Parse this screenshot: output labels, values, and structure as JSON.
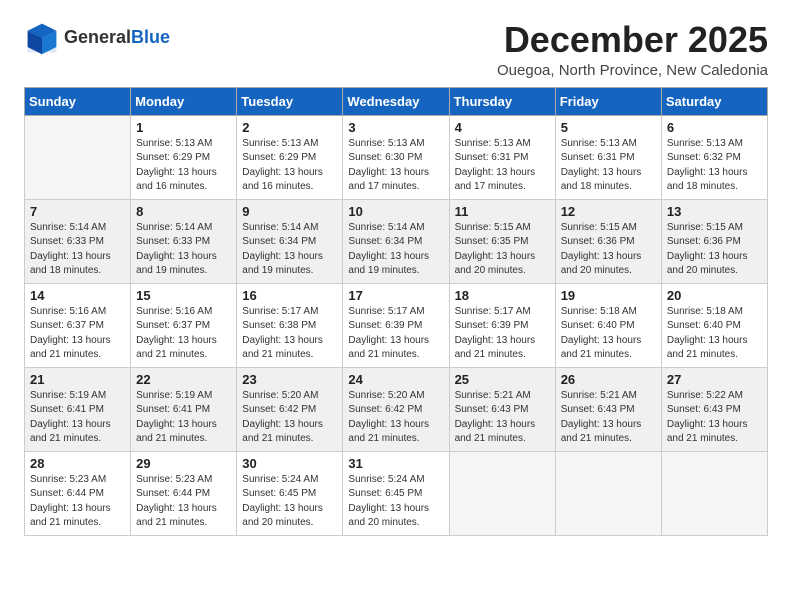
{
  "logo": {
    "general": "General",
    "blue": "Blue"
  },
  "header": {
    "month": "December 2025",
    "location": "Ouegoa, North Province, New Caledonia"
  },
  "weekdays": [
    "Sunday",
    "Monday",
    "Tuesday",
    "Wednesday",
    "Thursday",
    "Friday",
    "Saturday"
  ],
  "weeks": [
    [
      {
        "day": "",
        "sunrise": "",
        "sunset": "",
        "daylight": "",
        "empty": true
      },
      {
        "day": "1",
        "sunrise": "Sunrise: 5:13 AM",
        "sunset": "Sunset: 6:29 PM",
        "daylight": "Daylight: 13 hours and 16 minutes."
      },
      {
        "day": "2",
        "sunrise": "Sunrise: 5:13 AM",
        "sunset": "Sunset: 6:29 PM",
        "daylight": "Daylight: 13 hours and 16 minutes."
      },
      {
        "day": "3",
        "sunrise": "Sunrise: 5:13 AM",
        "sunset": "Sunset: 6:30 PM",
        "daylight": "Daylight: 13 hours and 17 minutes."
      },
      {
        "day": "4",
        "sunrise": "Sunrise: 5:13 AM",
        "sunset": "Sunset: 6:31 PM",
        "daylight": "Daylight: 13 hours and 17 minutes."
      },
      {
        "day": "5",
        "sunrise": "Sunrise: 5:13 AM",
        "sunset": "Sunset: 6:31 PM",
        "daylight": "Daylight: 13 hours and 18 minutes."
      },
      {
        "day": "6",
        "sunrise": "Sunrise: 5:13 AM",
        "sunset": "Sunset: 6:32 PM",
        "daylight": "Daylight: 13 hours and 18 minutes."
      }
    ],
    [
      {
        "day": "7",
        "sunrise": "Sunrise: 5:14 AM",
        "sunset": "Sunset: 6:33 PM",
        "daylight": "Daylight: 13 hours and 18 minutes."
      },
      {
        "day": "8",
        "sunrise": "Sunrise: 5:14 AM",
        "sunset": "Sunset: 6:33 PM",
        "daylight": "Daylight: 13 hours and 19 minutes."
      },
      {
        "day": "9",
        "sunrise": "Sunrise: 5:14 AM",
        "sunset": "Sunset: 6:34 PM",
        "daylight": "Daylight: 13 hours and 19 minutes."
      },
      {
        "day": "10",
        "sunrise": "Sunrise: 5:14 AM",
        "sunset": "Sunset: 6:34 PM",
        "daylight": "Daylight: 13 hours and 19 minutes."
      },
      {
        "day": "11",
        "sunrise": "Sunrise: 5:15 AM",
        "sunset": "Sunset: 6:35 PM",
        "daylight": "Daylight: 13 hours and 20 minutes."
      },
      {
        "day": "12",
        "sunrise": "Sunrise: 5:15 AM",
        "sunset": "Sunset: 6:36 PM",
        "daylight": "Daylight: 13 hours and 20 minutes."
      },
      {
        "day": "13",
        "sunrise": "Sunrise: 5:15 AM",
        "sunset": "Sunset: 6:36 PM",
        "daylight": "Daylight: 13 hours and 20 minutes."
      }
    ],
    [
      {
        "day": "14",
        "sunrise": "Sunrise: 5:16 AM",
        "sunset": "Sunset: 6:37 PM",
        "daylight": "Daylight: 13 hours and 21 minutes."
      },
      {
        "day": "15",
        "sunrise": "Sunrise: 5:16 AM",
        "sunset": "Sunset: 6:37 PM",
        "daylight": "Daylight: 13 hours and 21 minutes."
      },
      {
        "day": "16",
        "sunrise": "Sunrise: 5:17 AM",
        "sunset": "Sunset: 6:38 PM",
        "daylight": "Daylight: 13 hours and 21 minutes."
      },
      {
        "day": "17",
        "sunrise": "Sunrise: 5:17 AM",
        "sunset": "Sunset: 6:39 PM",
        "daylight": "Daylight: 13 hours and 21 minutes."
      },
      {
        "day": "18",
        "sunrise": "Sunrise: 5:17 AM",
        "sunset": "Sunset: 6:39 PM",
        "daylight": "Daylight: 13 hours and 21 minutes."
      },
      {
        "day": "19",
        "sunrise": "Sunrise: 5:18 AM",
        "sunset": "Sunset: 6:40 PM",
        "daylight": "Daylight: 13 hours and 21 minutes."
      },
      {
        "day": "20",
        "sunrise": "Sunrise: 5:18 AM",
        "sunset": "Sunset: 6:40 PM",
        "daylight": "Daylight: 13 hours and 21 minutes."
      }
    ],
    [
      {
        "day": "21",
        "sunrise": "Sunrise: 5:19 AM",
        "sunset": "Sunset: 6:41 PM",
        "daylight": "Daylight: 13 hours and 21 minutes."
      },
      {
        "day": "22",
        "sunrise": "Sunrise: 5:19 AM",
        "sunset": "Sunset: 6:41 PM",
        "daylight": "Daylight: 13 hours and 21 minutes."
      },
      {
        "day": "23",
        "sunrise": "Sunrise: 5:20 AM",
        "sunset": "Sunset: 6:42 PM",
        "daylight": "Daylight: 13 hours and 21 minutes."
      },
      {
        "day": "24",
        "sunrise": "Sunrise: 5:20 AM",
        "sunset": "Sunset: 6:42 PM",
        "daylight": "Daylight: 13 hours and 21 minutes."
      },
      {
        "day": "25",
        "sunrise": "Sunrise: 5:21 AM",
        "sunset": "Sunset: 6:43 PM",
        "daylight": "Daylight: 13 hours and 21 minutes."
      },
      {
        "day": "26",
        "sunrise": "Sunrise: 5:21 AM",
        "sunset": "Sunset: 6:43 PM",
        "daylight": "Daylight: 13 hours and 21 minutes."
      },
      {
        "day": "27",
        "sunrise": "Sunrise: 5:22 AM",
        "sunset": "Sunset: 6:43 PM",
        "daylight": "Daylight: 13 hours and 21 minutes."
      }
    ],
    [
      {
        "day": "28",
        "sunrise": "Sunrise: 5:23 AM",
        "sunset": "Sunset: 6:44 PM",
        "daylight": "Daylight: 13 hours and 21 minutes."
      },
      {
        "day": "29",
        "sunrise": "Sunrise: 5:23 AM",
        "sunset": "Sunset: 6:44 PM",
        "daylight": "Daylight: 13 hours and 21 minutes."
      },
      {
        "day": "30",
        "sunrise": "Sunrise: 5:24 AM",
        "sunset": "Sunset: 6:45 PM",
        "daylight": "Daylight: 13 hours and 20 minutes."
      },
      {
        "day": "31",
        "sunrise": "Sunrise: 5:24 AM",
        "sunset": "Sunset: 6:45 PM",
        "daylight": "Daylight: 13 hours and 20 minutes."
      },
      {
        "day": "",
        "sunrise": "",
        "sunset": "",
        "daylight": "",
        "empty": true
      },
      {
        "day": "",
        "sunrise": "",
        "sunset": "",
        "daylight": "",
        "empty": true
      },
      {
        "day": "",
        "sunrise": "",
        "sunset": "",
        "daylight": "",
        "empty": true
      }
    ]
  ]
}
